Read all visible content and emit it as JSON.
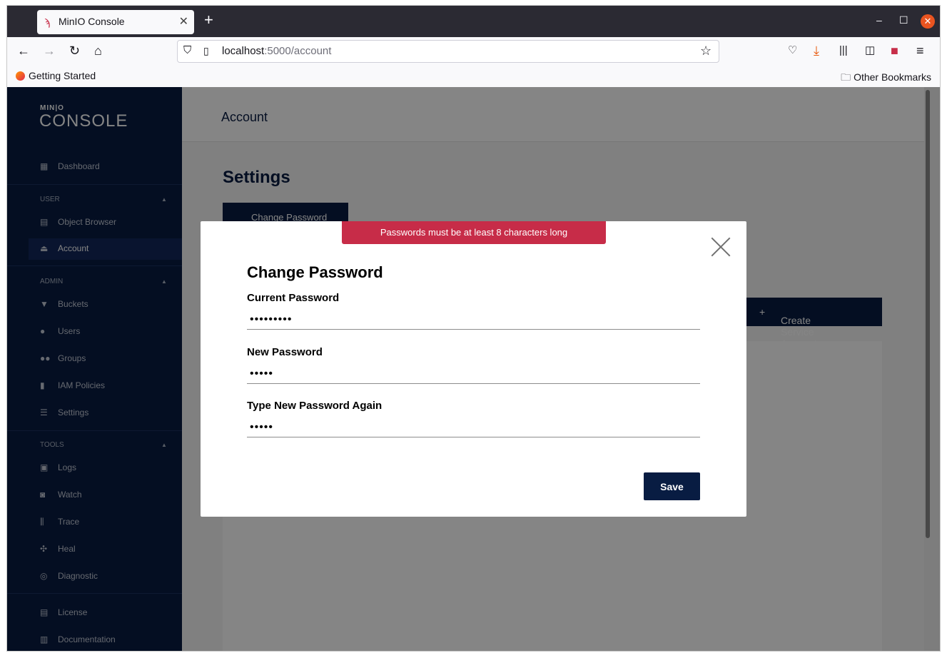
{
  "browser": {
    "tab_title": "MinIO Console",
    "url_host": "localhost",
    "url_path": ":5000/account",
    "bookmark_left": "Getting Started",
    "bookmark_right": "Other Bookmarks"
  },
  "sidebar": {
    "logo_small": "MIN|O",
    "logo_big": "CONSOLE",
    "dashboard": "Dashboard",
    "sections": {
      "user": "USER",
      "admin": "ADMIN",
      "tools": "TOOLS"
    },
    "items": {
      "object_browser": "Object Browser",
      "account": "Account",
      "buckets": "Buckets",
      "users": "Users",
      "groups": "Groups",
      "iam_policies": "IAM Policies",
      "settings": "Settings",
      "logs": "Logs",
      "watch": "Watch",
      "trace": "Trace",
      "heal": "Heal",
      "diagnostic": "Diagnostic",
      "license": "License",
      "documentation": "Documentation"
    }
  },
  "main": {
    "header_title": "Account",
    "settings_title": "Settings",
    "change_password_tab": "Change Password",
    "create_service_account": "Create Service Account"
  },
  "modal": {
    "alert": "Passwords must be at least 8 characters long",
    "title": "Change Password",
    "current_password_label": "Current Password",
    "current_password_value": "•••••••••",
    "new_password_label": "New Password",
    "new_password_value": "•••••",
    "confirm_password_label": "Type New Password Again",
    "confirm_password_value": "•••••",
    "save_label": "Save"
  }
}
